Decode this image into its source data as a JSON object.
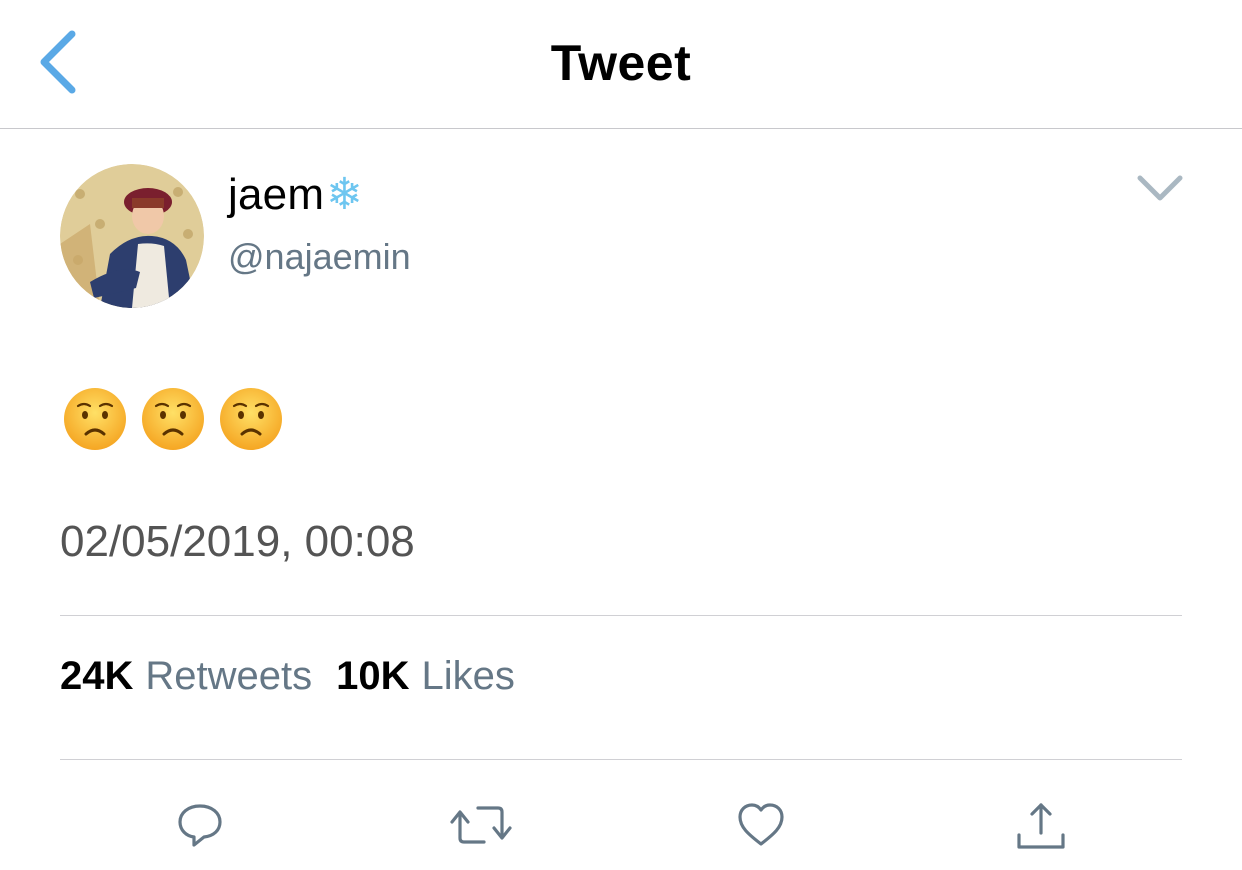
{
  "nav": {
    "title": "Tweet",
    "back_icon": "chevron-left-icon"
  },
  "tweet": {
    "author": {
      "display_name": "jaem",
      "name_emoji": "❄",
      "handle": "@najaemin"
    },
    "text_emojis": [
      "worried-face",
      "worried-face",
      "worried-face"
    ],
    "timestamp": "02/05/2019, 00:08"
  },
  "stats": {
    "retweets_count": "24K",
    "retweets_label": "Retweets",
    "likes_count": "10K",
    "likes_label": "Likes"
  },
  "actions": {
    "icons": [
      "reply-icon",
      "retweet-icon",
      "like-icon",
      "share-icon"
    ]
  },
  "colors": {
    "accent": "#1da1f2",
    "secondary_text": "#657786",
    "icon": "#657786"
  }
}
